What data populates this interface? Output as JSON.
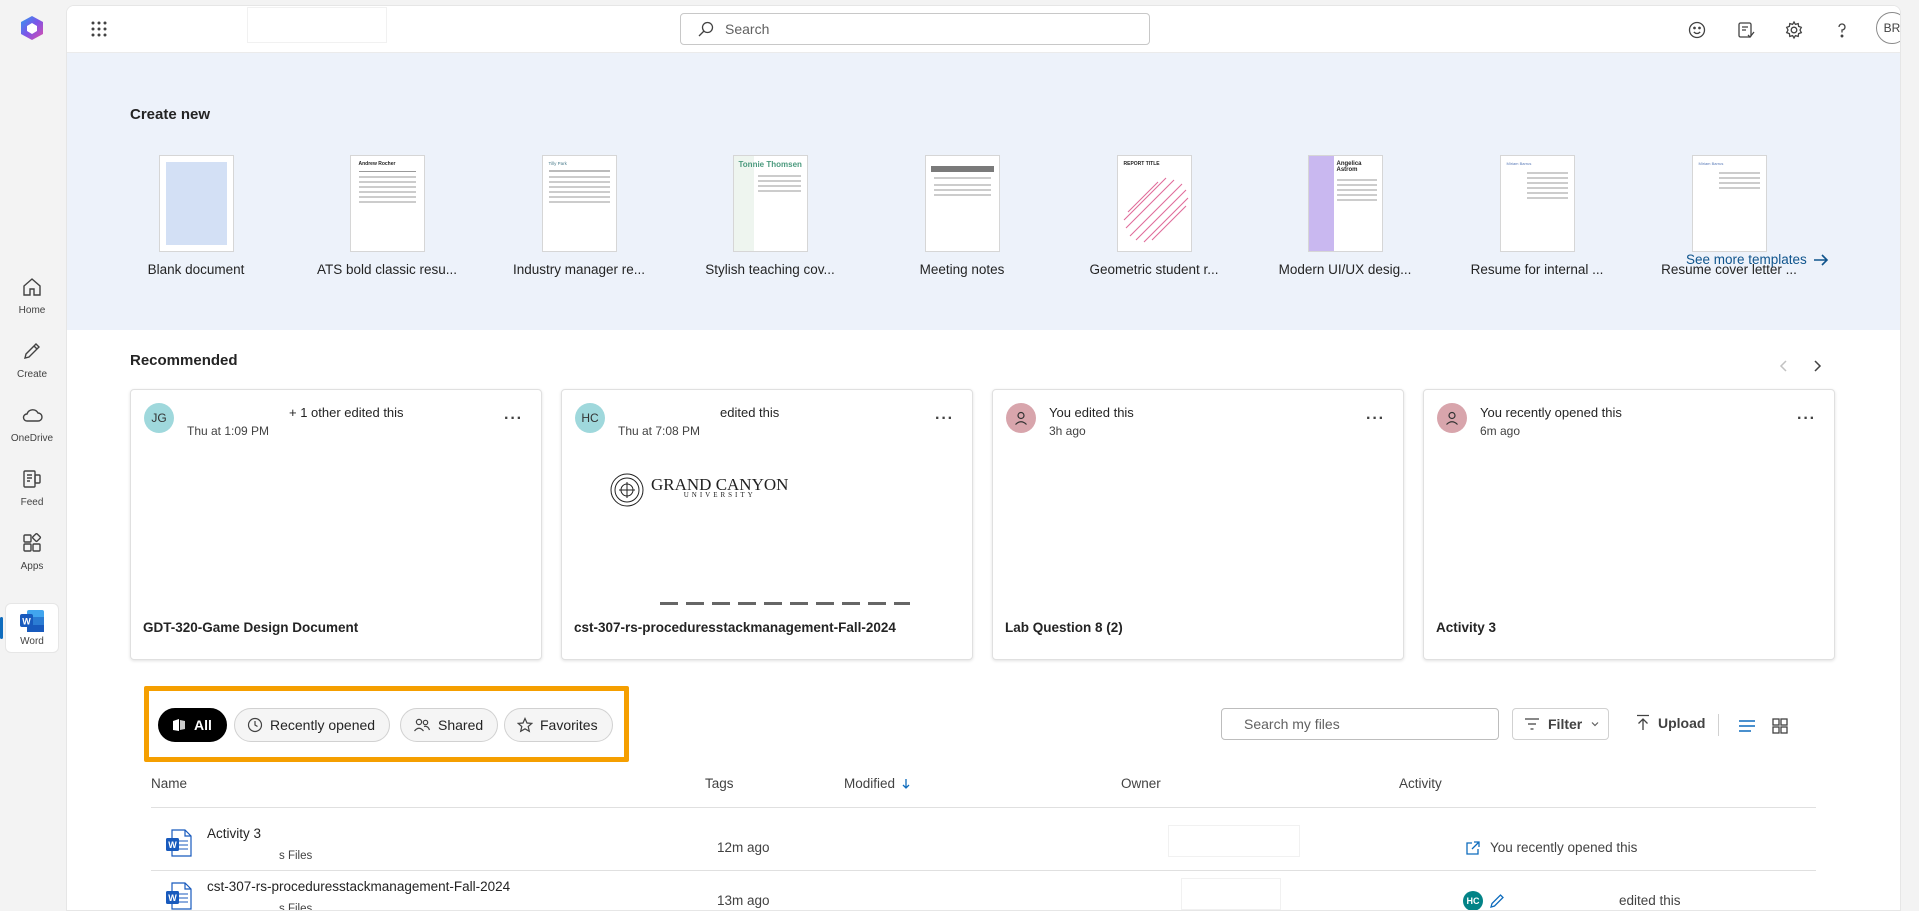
{
  "rail": {
    "items": [
      {
        "label": "Home"
      },
      {
        "label": "Create"
      },
      {
        "label": "OneDrive"
      },
      {
        "label": "Feed"
      },
      {
        "label": "Apps"
      },
      {
        "label": "Word"
      }
    ]
  },
  "topbar": {
    "search_placeholder": "Search",
    "avatar_initials": "BR"
  },
  "create_new": {
    "title": "Create new",
    "templates": [
      {
        "name": "Blank document"
      },
      {
        "name": "ATS bold classic resu...",
        "thumb_heading": "Andrew Rocher"
      },
      {
        "name": "Industry manager re...",
        "thumb_heading": "Tilly Park"
      },
      {
        "name": "Stylish teaching cov...",
        "thumb_heading": "Tonnie Thomsen"
      },
      {
        "name": "Meeting notes"
      },
      {
        "name": "Geometric student r...",
        "thumb_heading": "REPORT TITLE"
      },
      {
        "name": "Modern UI/UX desig...",
        "thumb_heading": "Angelica Astrom"
      },
      {
        "name": "Resume for internal ...",
        "thumb_heading": "Miriam Barrus"
      },
      {
        "name": "Resume cover letter ...",
        "thumb_heading": "Miriam Barrus"
      }
    ],
    "see_more": "See more templates"
  },
  "recommended": {
    "title": "Recommended",
    "cards": [
      {
        "initials": "JG",
        "activity": "+ 1 other edited this",
        "time": "Thu at 1:09 PM",
        "title": "GDT-320-Game Design Document",
        "avatar_color": "#9fd8dc"
      },
      {
        "initials": "HC",
        "activity": "edited this",
        "time": "Thu at 7:08 PM",
        "title": "cst-307-rs-proceduresstackmanagement-Fall-2024",
        "avatar_color": "#9fd8dc",
        "preview_logo": "GRAND CANYON",
        "preview_logo_sub": "UNIVERSITY"
      },
      {
        "initials": "",
        "activity": "You edited this",
        "time": "3h ago",
        "title": "Lab Question 8 (2)",
        "avatar_color": "#d8a5ac"
      },
      {
        "initials": "",
        "activity": "You recently opened this",
        "time": "6m ago",
        "title": "Activity 3",
        "avatar_color": "#d8a5ac"
      }
    ]
  },
  "files": {
    "pills": [
      {
        "label": "All",
        "active": true
      },
      {
        "label": "Recently opened",
        "active": false
      },
      {
        "label": "Shared",
        "active": false
      },
      {
        "label": "Favorites",
        "active": false
      }
    ],
    "search_placeholder": "Search my files",
    "filter_label": "Filter",
    "upload_label": "Upload",
    "columns": {
      "name": "Name",
      "tags": "Tags",
      "modified": "Modified",
      "owner": "Owner",
      "activity": "Activity"
    },
    "rows": [
      {
        "name": "Activity 3",
        "location": "s Files",
        "modified": "12m ago",
        "activity": "You recently opened this"
      },
      {
        "name": "cst-307-rs-proceduresstackmanagement-Fall-2024",
        "location": "s Files",
        "modified": "13m ago",
        "activity_initials": "HC",
        "activity": "edited this"
      }
    ]
  },
  "colors": {
    "accent": "#0f6cbd",
    "highlight_box": "#f59f00",
    "create_bg": "#edf2fa",
    "word_blue": "#185abd"
  }
}
